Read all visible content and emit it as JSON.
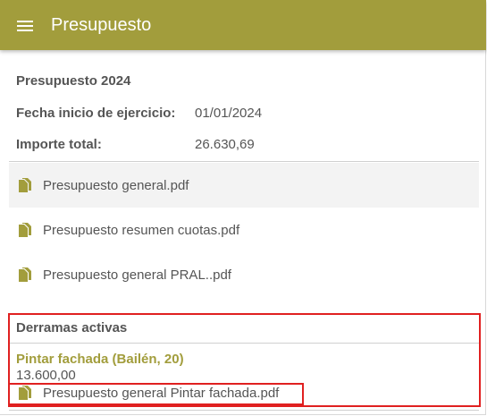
{
  "header": {
    "title": "Presupuesto"
  },
  "budget": {
    "title": "Presupuesto 2024",
    "start_label": "Fecha inicio de ejercicio:",
    "start_value": "01/01/2024",
    "total_label": "Importe total:",
    "total_value": "26.630,69"
  },
  "files": [
    {
      "name": "Presupuesto general.pdf",
      "icon": "pdf-file-icon"
    },
    {
      "name": "Presupuesto resumen cuotas.pdf",
      "icon": "pdf-file-icon"
    },
    {
      "name": "Presupuesto general PRAL..pdf",
      "icon": "pdf-file-icon"
    }
  ],
  "derramas": {
    "title": "Derramas activas",
    "items": [
      {
        "name": "Pintar fachada (Bailén, 20)",
        "amount": "13.600,00",
        "file": "Presupuesto general Pintar fachada.pdf"
      }
    ]
  },
  "colors": {
    "accent": "#a29d3c",
    "highlight": "#e02020",
    "text": "#555555"
  }
}
